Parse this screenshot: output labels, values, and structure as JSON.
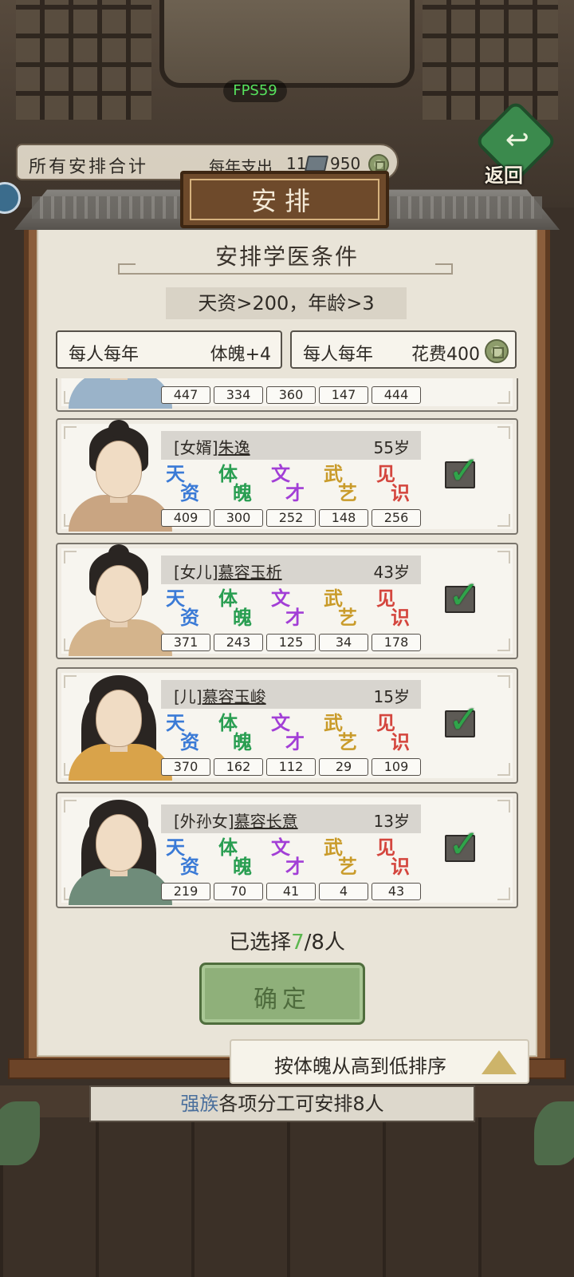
{
  "fps": "FPS59",
  "summary": {
    "title": "所有安排合计",
    "spend_label": "每年支出",
    "tuition": "11",
    "coins": "950",
    "book_icon": "book-icon",
    "coin_icon": "coin-icon"
  },
  "back_button": {
    "label": "返回",
    "icon": "return-arrow-icon"
  },
  "panel": {
    "title": "安排",
    "condition_title": "安排学医条件",
    "condition": "天资>200，年龄>3",
    "effects": [
      {
        "label": "每人每年",
        "value": "体魄+4"
      },
      {
        "label": "每人每年",
        "value": "花费400"
      }
    ]
  },
  "stat_labels": [
    {
      "g1": "天",
      "g2": "资",
      "color": "#3a7ad6"
    },
    {
      "g1": "体",
      "g2": "魄",
      "color": "#2a9e52"
    },
    {
      "g1": "文",
      "g2": "才",
      "color": "#a23ed6"
    },
    {
      "g1": "武",
      "g2": "艺",
      "color": "#c99b2a"
    },
    {
      "g1": "见",
      "g2": "识",
      "color": "#d4463e"
    }
  ],
  "members": [
    {
      "relation": "",
      "name": "",
      "age": "",
      "stats": [
        "447",
        "334",
        "360",
        "147",
        "444"
      ],
      "checked": false,
      "robe": "#9ab3c9"
    },
    {
      "relation": "[女婿]",
      "name": "朱逸",
      "age": "55岁",
      "stats": [
        "409",
        "300",
        "252",
        "148",
        "256"
      ],
      "checked": true,
      "robe": "#c9a582"
    },
    {
      "relation": "[女儿]",
      "name": "慕容玉析",
      "age": "43岁",
      "stats": [
        "371",
        "243",
        "125",
        "34",
        "178"
      ],
      "checked": true,
      "robe": "#d4b48c"
    },
    {
      "relation": "[儿]",
      "name": "慕容玉峻",
      "age": "15岁",
      "stats": [
        "370",
        "162",
        "112",
        "29",
        "109"
      ],
      "checked": true,
      "robe": "#d9a34a"
    },
    {
      "relation": "[外孙女]",
      "name": "慕容长意",
      "age": "13岁",
      "stats": [
        "219",
        "70",
        "41",
        "4",
        "43"
      ],
      "checked": true,
      "robe": "#6f8c7a"
    }
  ],
  "selection": {
    "prefix": "已选择",
    "selected": "7",
    "total": "/8人"
  },
  "confirm_label": "确定",
  "sort_label": "按体魄从高到低排序",
  "info": {
    "clan": "强族",
    "text": "各项分工可安排8人"
  }
}
